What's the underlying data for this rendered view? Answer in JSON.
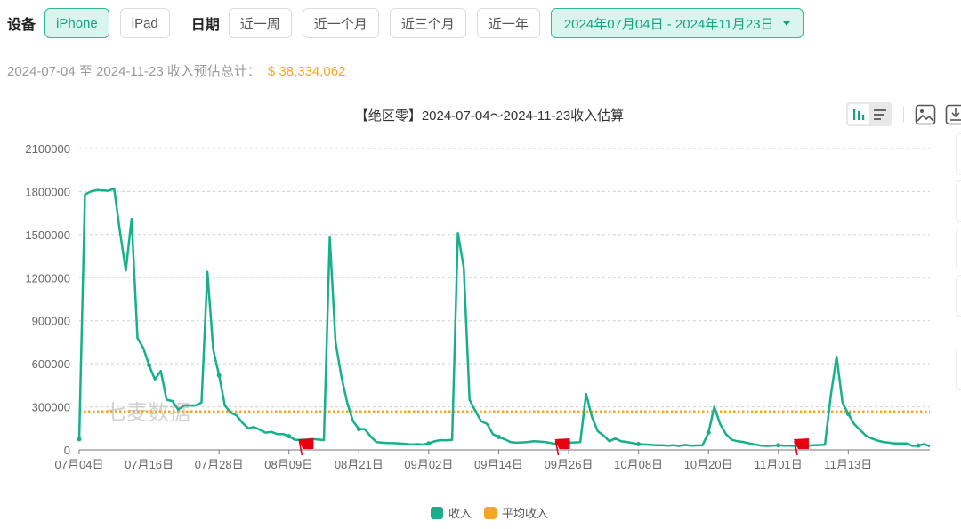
{
  "filters": {
    "device_label": "设备",
    "devices": [
      {
        "label": "iPhone",
        "active": true
      },
      {
        "label": "iPad",
        "active": false
      }
    ],
    "date_label": "日期",
    "presets": [
      "近一周",
      "近一个月",
      "近三个月",
      "近一年"
    ],
    "date_range": "2024年07月04日 - 2024年11月23日"
  },
  "summary": {
    "text": "2024-07-04 至 2024-11-23 收入预估总计：",
    "amount": "$ 38,334,062"
  },
  "toolbar": {
    "icons": [
      "bar-chart-icon",
      "list-icon",
      "image-export-icon",
      "download-icon"
    ]
  },
  "watermark": "七麦数据",
  "colors": {
    "accent": "#14a37f",
    "revenue": "#16b08a",
    "average": "#f5a623",
    "flag": "#e60012"
  },
  "chart_data": {
    "type": "line",
    "title": "【绝区零】2024-07-04～2024-11-23收入估算",
    "xlabel": "",
    "ylabel": "",
    "ylim": [
      0,
      2100000
    ],
    "yticks": [
      0,
      300000,
      600000,
      900000,
      1200000,
      1500000,
      1800000,
      2100000
    ],
    "xticks": [
      "07月04日",
      "07月16日",
      "07月28日",
      "08月09日",
      "08月21日",
      "09月02日",
      "09月14日",
      "09月26日",
      "10月08日",
      "10月20日",
      "11月01日",
      "11月13日"
    ],
    "grid": true,
    "legend_position": "bottom-center",
    "start_date": "2024-07-04",
    "end_date": "2024-11-23",
    "series": [
      {
        "name": "收入",
        "color": "#16b08a",
        "values": [
          75000,
          1780000,
          1800000,
          1810000,
          1808000,
          1805000,
          1820000,
          1520000,
          1250000,
          1610000,
          780000,
          710000,
          590000,
          490000,
          550000,
          350000,
          340000,
          280000,
          310000,
          310000,
          310000,
          330000,
          1240000,
          700000,
          520000,
          310000,
          260000,
          240000,
          190000,
          150000,
          160000,
          140000,
          120000,
          125000,
          110000,
          110000,
          95000,
          70000,
          70000,
          72000,
          75000,
          72000,
          68000,
          1480000,
          750000,
          510000,
          330000,
          200000,
          145000,
          145000,
          95000,
          55000,
          50000,
          48000,
          47000,
          45000,
          42000,
          38000,
          40000,
          37000,
          45000,
          60000,
          68000,
          66000,
          70000,
          1510000,
          1270000,
          350000,
          270000,
          200000,
          180000,
          110000,
          90000,
          75000,
          55000,
          50000,
          52000,
          55000,
          60000,
          58000,
          55000,
          48000,
          40000,
          45000,
          50000,
          52000,
          54000,
          390000,
          230000,
          130000,
          100000,
          60000,
          80000,
          60000,
          55000,
          48000,
          40000,
          38000,
          36000,
          33000,
          33000,
          30000,
          32000,
          28000,
          35000,
          30000,
          31000,
          33000,
          120000,
          300000,
          180000,
          110000,
          70000,
          60000,
          55000,
          45000,
          38000,
          30000,
          28000,
          30000,
          32000,
          30000,
          29000,
          28000,
          27000,
          30000,
          32000,
          34000,
          36000,
          380000,
          650000,
          330000,
          250000,
          180000,
          140000,
          100000,
          80000,
          65000,
          55000,
          50000,
          45000,
          45000,
          45000,
          28000,
          30000,
          40000,
          25000
        ]
      },
      {
        "name": "平均收入",
        "color": "#f5a623",
        "values_constant": 268000
      }
    ],
    "markers": [
      {
        "type": "flag",
        "date": "2024-08-12"
      },
      {
        "type": "flag",
        "date": "2024-09-25"
      },
      {
        "type": "flag",
        "date": "2024-11-05"
      }
    ],
    "legend": [
      "收入",
      "平均收入"
    ]
  }
}
